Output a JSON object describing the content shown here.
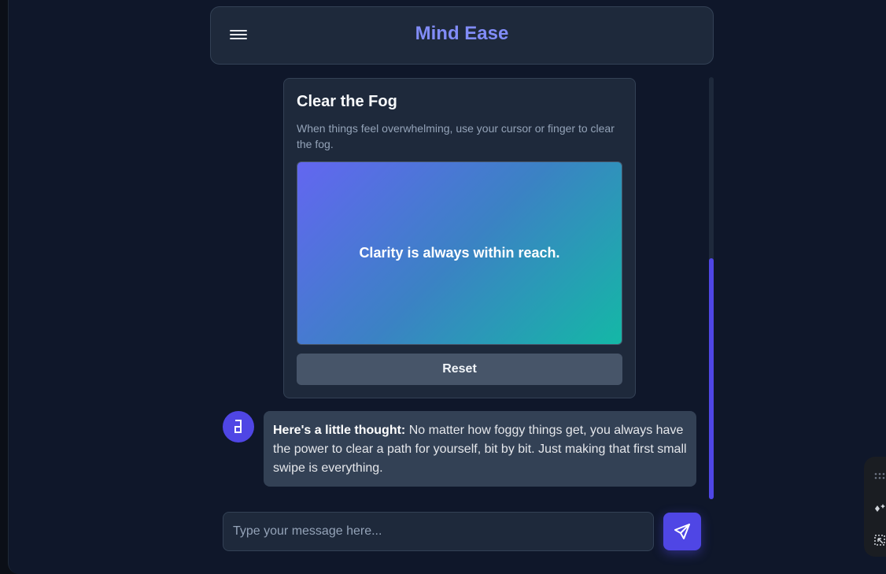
{
  "header": {
    "title": "Mind Ease",
    "menu_icon": "hamburger-menu-icon"
  },
  "fog_card": {
    "title": "Clear the Fog",
    "description": "When things feel overwhelming, use your cursor or finger to clear the fog.",
    "revealed_message": "Clarity is always within reach.",
    "reset_label": "Reset",
    "gradient_colors": [
      "#6366f1",
      "#3b82c4",
      "#14b8a6"
    ]
  },
  "message": {
    "avatar_icon": "bot-avatar-icon",
    "bold_lead": "Here's a little thought:",
    "body": " No matter how foggy things get, you always have the power to clear a path for yourself, bit by bit. Just making that first small swipe is everything."
  },
  "composer": {
    "placeholder": "Type your message here...",
    "value": "",
    "send_icon": "send-icon"
  },
  "side_toolbar": {
    "icons": [
      "drag-handle-icon",
      "sparkle-icon",
      "select-region-icon"
    ]
  },
  "colors": {
    "accent": "#4f46e5",
    "title_accent": "#818cf8",
    "background": "#0f172a",
    "card": "#1e293b"
  }
}
